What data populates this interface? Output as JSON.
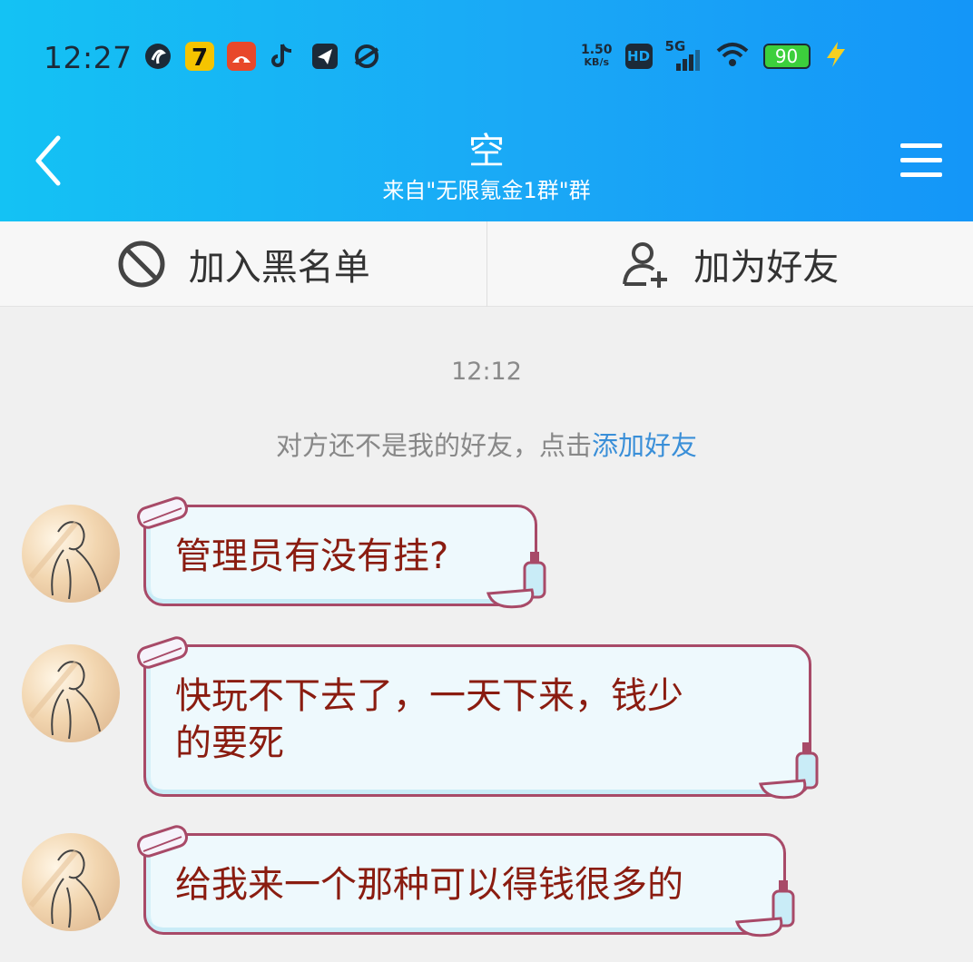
{
  "status_bar": {
    "time": "12:27",
    "net_speed_value": "1.50",
    "net_speed_unit": "KB/s",
    "hd": "HD",
    "network": "5G",
    "battery": "90"
  },
  "header": {
    "title": "空",
    "subtitle": "来自\"无限氪金1群\"群"
  },
  "actions": {
    "blacklist": "加入黑名单",
    "add_friend": "加为好友"
  },
  "chat": {
    "timestamp": "12:12",
    "notice_text": "对方还不是我的好友，点击",
    "notice_link": "添加好友",
    "messages": [
      {
        "line1": "管理员有没有挂?",
        "line2": ""
      },
      {
        "line1": "快玩不下去了，一天下来，钱少",
        "line2": "的要死"
      },
      {
        "line1": "给我来一个那种可以得钱很多的",
        "line2": ""
      }
    ]
  },
  "colors": {
    "header_start": "#14c2f4",
    "header_end": "#1496f8",
    "bubble_text": "#8a1c10",
    "bubble_border": "#a84a68",
    "link": "#3a8fd8"
  }
}
